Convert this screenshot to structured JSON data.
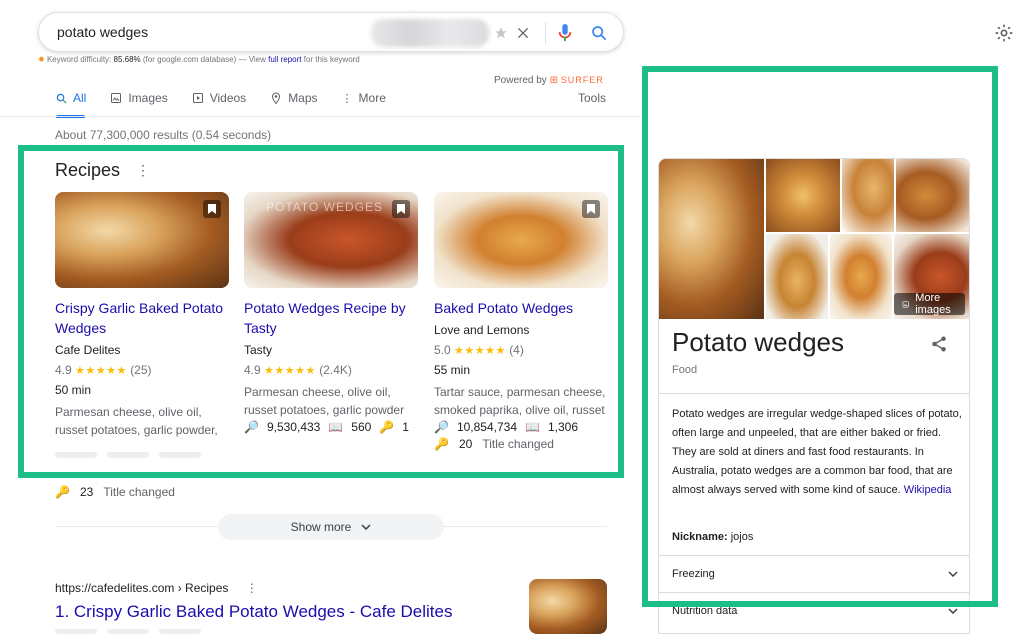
{
  "search": {
    "query": "potato wedges"
  },
  "keyword_difficulty": {
    "label": "Keyword difficulty:",
    "value": "85.68%",
    "database": "(for google.com database) — View",
    "link": "full report",
    "suffix": "for this keyword"
  },
  "powered_by": {
    "label": "Powered by",
    "brand": "SURFER"
  },
  "tabs": [
    {
      "label": "All",
      "icon": "search-icon",
      "active": true
    },
    {
      "label": "Images",
      "icon": "image-icon"
    },
    {
      "label": "Videos",
      "icon": "video-icon"
    },
    {
      "label": "Maps",
      "icon": "map-pin-icon"
    },
    {
      "label": "More",
      "icon": "kebab-icon"
    }
  ],
  "tools_label": "Tools",
  "results_count": "About 77,300,000 results (0.54 seconds)",
  "recipes": {
    "heading": "Recipes",
    "cards": [
      {
        "title_line1": "Crispy Garlic Baked Potato",
        "title_line2": "Wedges",
        "source": "Cafe Delites",
        "rating": "4.9",
        "reviews": "(25)",
        "time": "50 min",
        "ingredients_line1": "Parmesan cheese, olive oil,",
        "ingredients_line2": "russet potatoes, garlic powder,"
      },
      {
        "title_line1": "Potato Wedges Recipe by",
        "title_line2": "Tasty",
        "source": "Tasty",
        "rating": "4.9",
        "reviews": "(2.4K)",
        "time": "",
        "ingredients_line1": "Parmesan cheese, olive oil,",
        "ingredients_line2": "russet potatoes, garlic powder",
        "volume": "9,530,433",
        "pages": "560",
        "keys": "1"
      },
      {
        "title_line1": "Baked Potato Wedges",
        "title_line2": "",
        "source": "Love and Lemons",
        "rating": "5.0",
        "reviews": "(4)",
        "time": "55 min",
        "ingredients_line1": "Tartar sauce, parmesan cheese,",
        "ingredients_line2": "smoked paprika, olive oil, russet",
        "volume": "10,854,734",
        "pages": "1,306",
        "keys": "20",
        "status": "Title changed"
      }
    ],
    "image_overlay_text": "POTATO WEDGES"
  },
  "below_cards": {
    "keys": "23",
    "status": "Title changed"
  },
  "show_more": "Show more",
  "first_result": {
    "url": "https://cafedelites.com › Recipes",
    "title": "1. Crispy Garlic Baked Potato Wedges - Cafe Delites"
  },
  "knowledge_panel": {
    "title": "Potato wedges",
    "subtitle": "Food",
    "more_images": "More images",
    "description": "Potato wedges are irregular wedge-shaped slices of potato, often large and unpeeled, that are either baked or fried. They are sold at diners and fast food restaurants. In Australia, potato wedges are a common bar food, that are almost always served with some kind of sauce.",
    "wiki_link": "Wikipedia",
    "nickname_label": "Nickname:",
    "nickname_value": "jojos",
    "sections": [
      "Freezing",
      "Nutrition data"
    ]
  },
  "colors": {
    "highlight_border": "#1dbe86",
    "link": "#1a0dab",
    "accent": "#1a73e8",
    "star": "#fbbc04"
  }
}
